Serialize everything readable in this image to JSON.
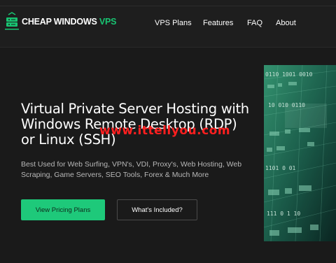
{
  "header": {
    "logo_text_white": "CHEAP WINDOWS ",
    "logo_text_green": "VPS",
    "nav": [
      "VPS Plans",
      "Features",
      "FAQ",
      "About"
    ]
  },
  "hero": {
    "title": "Virtual Private Server Hosting with Windows Remote Desktop (RDP) or Linux (SSH)",
    "description": "Best Used for Web Surfing, VPN's, VDI, Proxy's, Web Hosting, Web Scraping, Game Servers, SEO Tools, Forex & Much More",
    "primary_button": "View Pricing Plans",
    "secondary_button": "What's Included?"
  },
  "watermark": "www.ittellyou.com",
  "image_code_text": [
    "0110 1001 0010",
    "10 010 0110",
    "1101 0 01",
    "111 0 1 10"
  ],
  "colors": {
    "accent": "#1ec97a",
    "background": "#1a1a1a",
    "watermark": "#ff1f1f"
  },
  "icons": {
    "logo": "server-shield-icon"
  }
}
